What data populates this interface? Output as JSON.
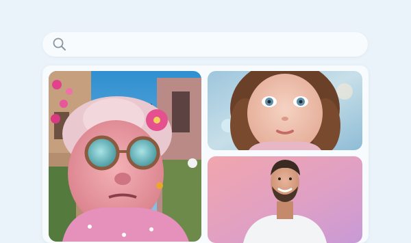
{
  "search": {
    "value": "",
    "icon": "search-icon"
  },
  "gallery": {
    "images": [
      {
        "name": "grandma-portrait-image"
      },
      {
        "name": "girl-portrait-image"
      },
      {
        "name": "man-portrait-image"
      }
    ]
  },
  "colors": {
    "page_background": "#eaf3f9",
    "surface": "#f7fbfe",
    "icon": "#8a949d"
  }
}
